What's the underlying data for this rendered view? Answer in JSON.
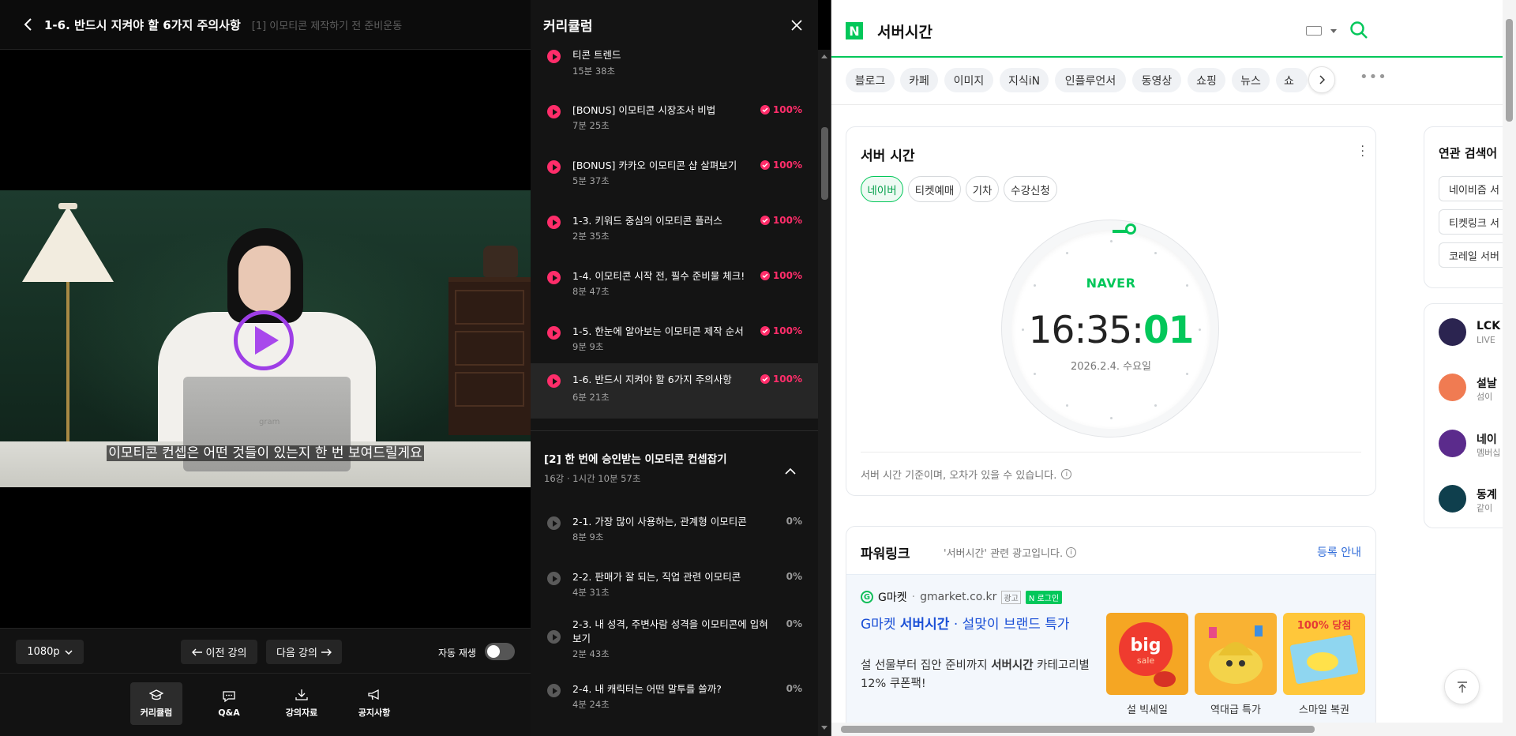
{
  "player": {
    "lesson_title": "1-6. 반드시 지켜야 할 6가지 주의사항",
    "section_title": "[1] 이모티콘 제작하기 전 준비운동",
    "subtitle": "이모티콘 컨셉은 어떤 것들이 있는지 한 번 보여드릴게요",
    "laptop_logo": "gram",
    "quality": "1080p",
    "prev_label": "이전 강의",
    "next_label": "다음 강의",
    "autoplay_label": "자동 재생",
    "autoplay_on": false,
    "tabs": [
      {
        "label": "커리큘럼",
        "icon": "curriculum-icon",
        "active": true
      },
      {
        "label": "Q&A",
        "icon": "chat-icon",
        "active": false
      },
      {
        "label": "강의자료",
        "icon": "download-icon",
        "active": false
      },
      {
        "label": "공지사항",
        "icon": "megaphone-icon",
        "active": false
      }
    ]
  },
  "curriculum": {
    "title": "커리큘럼",
    "section1_lessons": [
      {
        "title": "티콘 트렌드",
        "duration": "15분 38초",
        "progress": "100%",
        "done": true
      },
      {
        "title": "[BONUS] 이모티콘 시장조사 비법",
        "duration": "7분 25초",
        "progress": "100%",
        "done": true
      },
      {
        "title": "[BONUS] 카카오 이모티콘 샵 살펴보기",
        "duration": "5분 37초",
        "progress": "100%",
        "done": true
      },
      {
        "title": "1-3. 키워드 중심의 이모티콘 플러스",
        "duration": "2분 35초",
        "progress": "100%",
        "done": true
      },
      {
        "title": "1-4. 이모티콘 시작 전, 필수 준비물 체크!",
        "duration": "8분 47초",
        "progress": "100%",
        "done": true
      },
      {
        "title": "1-5. 한눈에 알아보는 이모티콘 제작 순서",
        "duration": "9분 9초",
        "progress": "100%",
        "done": true
      },
      {
        "title": "1-6. 반드시 지켜야 할 6가지 주의사항",
        "duration": "6분 21초",
        "progress": "100%",
        "done": true,
        "current": true
      }
    ],
    "section2": {
      "title": "[2] 한 번에 승인받는 이모티콘 컨셉잡기",
      "meta": "16강 · 1시간 10분 57초"
    },
    "section2_lessons": [
      {
        "title": "2-1. 가장 많이 사용하는, 관계형 이모티콘",
        "duration": "8분 9초",
        "progress": "0%",
        "done": false
      },
      {
        "title": "2-2. 판매가 잘 되는, 직업 관련 이모티콘",
        "duration": "4분 31초",
        "progress": "0%",
        "done": false
      },
      {
        "title": "2-3. 내 성격, 주변사람 성격을 이모티콘에 입혀보기",
        "duration": "2분 43초",
        "progress": "0%",
        "done": false
      },
      {
        "title": "2-4. 내 캐릭터는 어떤 말투를 쓸까?",
        "duration": "4분 24초",
        "progress": "0%",
        "done": false
      }
    ]
  },
  "naver": {
    "logo": "N",
    "query": "서버시간",
    "tabs": [
      "블로그",
      "카페",
      "이미지",
      "지식iN",
      "인플루언서",
      "동영상",
      "쇼핑",
      "뉴스",
      "쇼"
    ],
    "server_card": {
      "title": "서버 시간",
      "chips": [
        "네이버",
        "티켓예매",
        "기차",
        "수강신청"
      ],
      "brand": "NAVER",
      "time_hm": "16:35:",
      "time_s": "01",
      "date": "2026.2.4. 수요일",
      "note": "서버 시간 기준이며, 오차가 있을 수 있습니다."
    },
    "ad": {
      "title": "파워링크",
      "subtitle": "'서버시간' 관련 광고입니다.",
      "register": "등록 안내",
      "source_name": "G마켓",
      "source_url": "gmarket.co.kr",
      "ad_badge": "광고",
      "login_badge": "N 로그인",
      "headline_pre": "G마켓 ",
      "headline_bold": "서버시간",
      "headline_post": " · 설맞이 브랜드 특가",
      "desc_pre": "설 선물부터 집안 준비까지 ",
      "desc_bold": "서버시간",
      "desc_post": " 카테고리별 12% 쿠폰팩!",
      "thumbs": [
        {
          "caption": "설 빅세일",
          "color": "#f5a623"
        },
        {
          "caption": "역대급 특가",
          "color": "#f9b233"
        },
        {
          "caption": "스마일 복권",
          "color": "#ffc73a"
        }
      ],
      "thumb_text_big": "big",
      "thumb_text_sale": "sale",
      "thumb_text_win": "100% 당첨"
    },
    "related": {
      "title": "연관 검색어",
      "items": [
        "네이비즘 서",
        "티켓링크 서",
        "코레일 서버"
      ]
    },
    "live": [
      {
        "name": "LCK",
        "sub": "LIVE",
        "color": "#2b2450"
      },
      {
        "name": "설날",
        "sub": "섬이",
        "color": "#f07b52"
      },
      {
        "name": "네이",
        "sub": "멤버십",
        "color": "#5b2b8c"
      },
      {
        "name": "동계",
        "sub": "같이",
        "color": "#0f3f4d"
      }
    ]
  }
}
